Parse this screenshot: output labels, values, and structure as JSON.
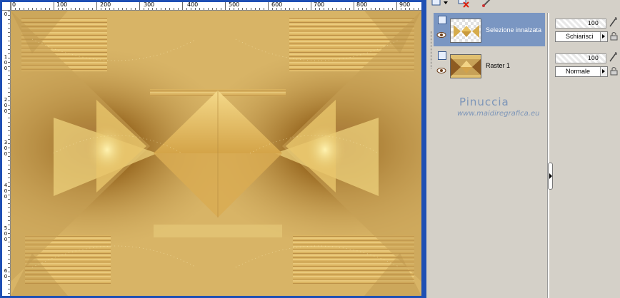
{
  "canvas": {
    "ruler_h_labels": [
      "0",
      "100",
      "200",
      "300",
      "400",
      "500",
      "600",
      "700",
      "800",
      "900"
    ],
    "ruler_v_labels": [
      [
        "0"
      ],
      [
        "1",
        "0",
        "0"
      ],
      [
        "2",
        "0",
        "0"
      ],
      [
        "3",
        "0",
        "0"
      ],
      [
        "4",
        "0",
        "0"
      ],
      [
        "5",
        "0",
        "0"
      ],
      [
        "6",
        "0"
      ]
    ]
  },
  "layers": [
    {
      "name": "Selezione innalzata",
      "opacity": "100",
      "blend_mode": "Schiarisci",
      "selected": true
    },
    {
      "name": "Raster 1",
      "opacity": "100",
      "blend_mode": "Normale",
      "selected": false
    }
  ],
  "toolbar": {
    "icons": [
      "new-layer-icon",
      "delete-layer-icon",
      "edit-icon"
    ]
  },
  "watermark": {
    "title": "Pinuccia",
    "url": "www.maidiregrafica.eu"
  },
  "colors": {
    "window_frame": "#1e4fb4",
    "panel_bg": "#d4d0c8",
    "selected_row": "#7a96c2",
    "watermark": "#7c95b8"
  }
}
